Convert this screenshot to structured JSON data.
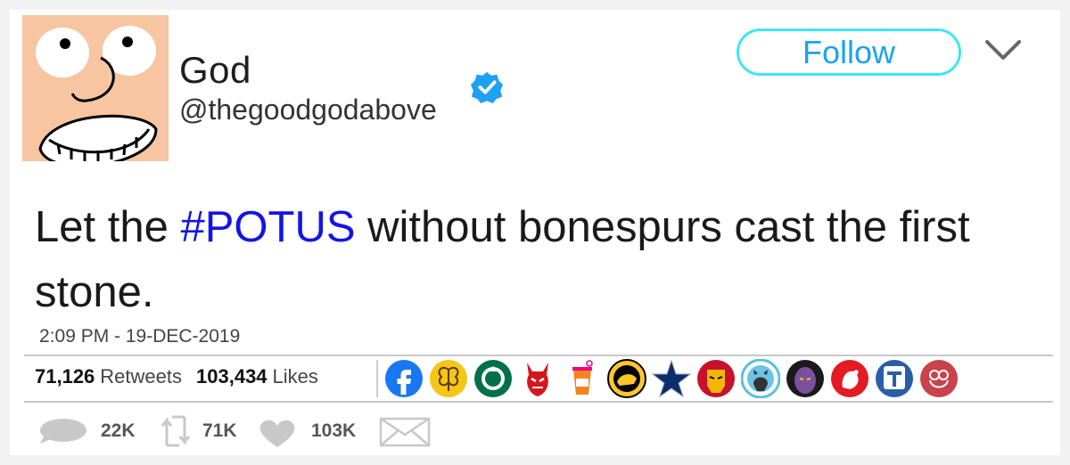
{
  "header": {
    "display_name": "God",
    "handle": "@thegoodgodabove",
    "follow_label": "Follow"
  },
  "tweet": {
    "text_before": "Let the ",
    "hashtag": "#POTUS",
    "text_after": " without bonespurs cast the first stone.",
    "timestamp": "2:09 PM - 19-DEC-2019"
  },
  "stats": {
    "retweets_count": "71,126",
    "retweets_label": "Retweets",
    "likes_count": "103,434",
    "likes_label": "Likes"
  },
  "liker_avatars": [
    "facebook-logo",
    "honey-bee-logo",
    "starbucks-logo",
    "red-devil-logo",
    "dunkin-cup-logo",
    "buffalo-wild-wings-logo",
    "dallas-star-logo",
    "iron-man-logo",
    "github-octocat-logo",
    "thanos-logo",
    "rooster-logo",
    "t-mobile-logo",
    "owl-logo"
  ],
  "actions": {
    "reply_count": "22K",
    "retweet_count": "71K",
    "like_count": "103K"
  },
  "colors": {
    "accent": "#1da1f2",
    "follow_border": "#3ee6f5",
    "hashtag": "#1414e6",
    "avatar_skin": "#f7c6a0"
  }
}
